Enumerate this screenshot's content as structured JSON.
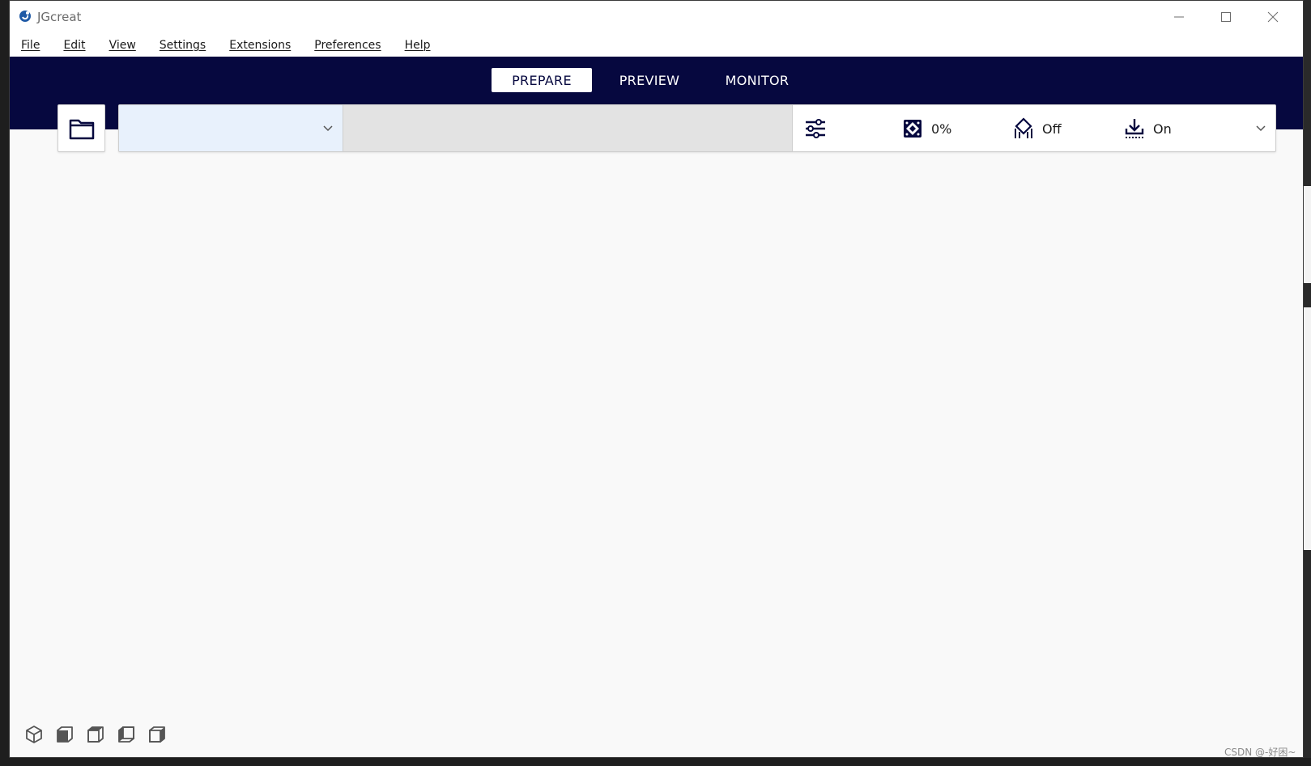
{
  "window": {
    "title": "JGcreat",
    "icons": {
      "app": "app-logo-icon",
      "minimize": "minimize-icon",
      "maximize": "maximize-icon",
      "close": "close-icon"
    }
  },
  "menubar": {
    "items": [
      {
        "label": "File"
      },
      {
        "label": "Edit"
      },
      {
        "label": "View"
      },
      {
        "label": "Settings"
      },
      {
        "label": "Extensions"
      },
      {
        "label": "Preferences"
      },
      {
        "label": "Help"
      }
    ]
  },
  "stages": {
    "tabs": [
      {
        "label": "PREPARE",
        "active": true
      },
      {
        "label": "PREVIEW",
        "active": false
      },
      {
        "label": "MONITOR",
        "active": false
      }
    ]
  },
  "toolbar": {
    "open_icon": "folder-icon",
    "printer_select_value": "",
    "printer_select_icon": "chevron-down-icon",
    "settings_icon": "sliders-icon",
    "infill": {
      "icon": "infill-icon",
      "value": "0%"
    },
    "support": {
      "icon": "support-icon",
      "value": "Off"
    },
    "adhesion": {
      "icon": "adhesion-icon",
      "value": "On"
    },
    "expand_icon": "chevron-down-icon"
  },
  "view_orientation": {
    "buttons": [
      {
        "icon": "view-3d-icon"
      },
      {
        "icon": "view-front-icon"
      },
      {
        "icon": "view-top-icon"
      },
      {
        "icon": "view-left-icon"
      },
      {
        "icon": "view-right-icon"
      }
    ]
  },
  "watermark": "CSDN @-好困~",
  "colors": {
    "stage_bar": "#06083f",
    "printer_select_bg": "#e8f1fc",
    "material_bg": "#e3e3e3",
    "viewport_bg": "#f9f9f9"
  }
}
